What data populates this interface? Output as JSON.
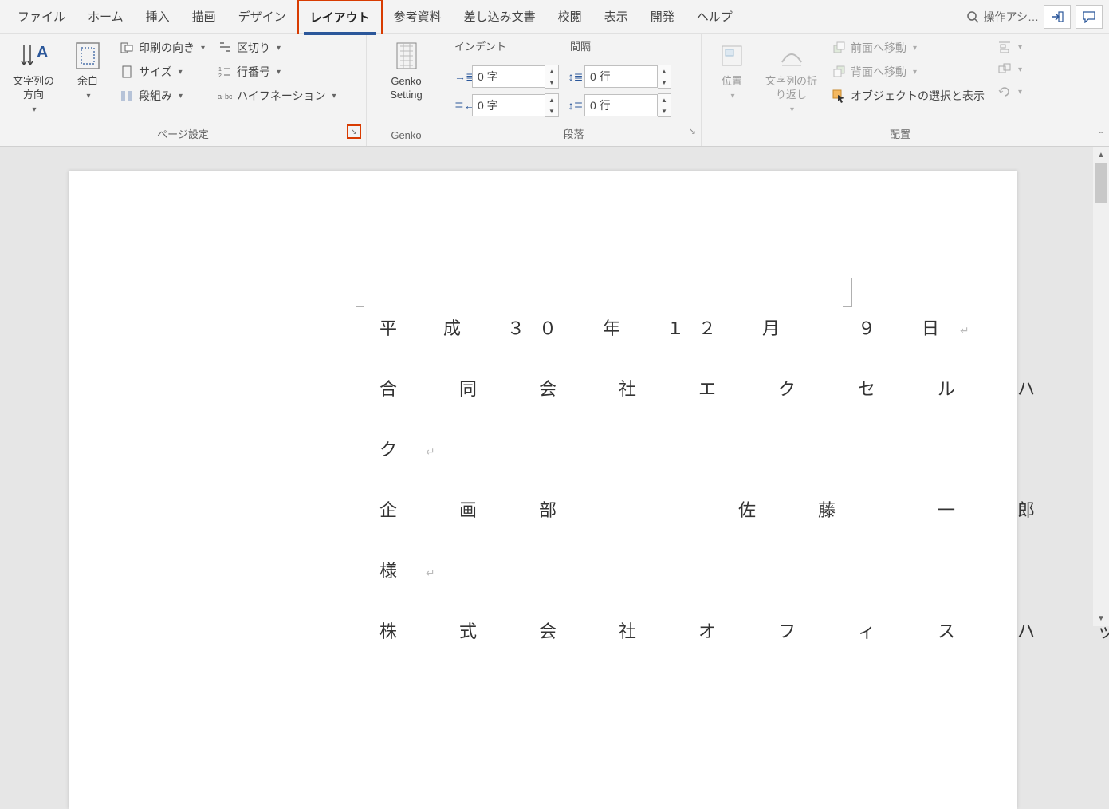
{
  "tabs": [
    "ファイル",
    "ホーム",
    "挿入",
    "描画",
    "デザイン",
    "レイアウト",
    "参考資料",
    "差し込み文書",
    "校閲",
    "表示",
    "開発",
    "ヘルプ"
  ],
  "active_tab_index": 5,
  "tell_me": "操作アシ…",
  "ribbon": {
    "page_setup": {
      "text_direction": "文字列の\n方向",
      "margins": "余白",
      "orientation": "印刷の向き",
      "size": "サイズ",
      "columns": "段組み",
      "breaks": "区切り",
      "line_numbers": "行番号",
      "hyphenation": "ハイフネーション",
      "label": "ページ設定"
    },
    "genko": {
      "setting": "Genko\nSetting",
      "label": "Genko"
    },
    "paragraph": {
      "indent_label": "インデント",
      "spacing_label": "間隔",
      "indent_left": "0 字",
      "indent_right": "0 字",
      "space_before": "0 行",
      "space_after": "0 行",
      "label": "段落"
    },
    "arrange": {
      "position": "位置",
      "wrap": "文字列の折\nり返し",
      "bring_forward": "前面へ移動",
      "send_backward": "背面へ移動",
      "selection_pane": "オブジェクトの選択と表示",
      "label": "配置"
    }
  },
  "document": {
    "lines": [
      "平　成　３０　年　１２　月　　９　日",
      "合　同　会　社　エ　ク　セ　ル　ハ　ッ",
      "ク",
      "企　画　部　　　　佐　藤　　一　郎",
      "様",
      "株　式　会　社　オ　フ　ィ　ス　ハ　ッ"
    ]
  }
}
